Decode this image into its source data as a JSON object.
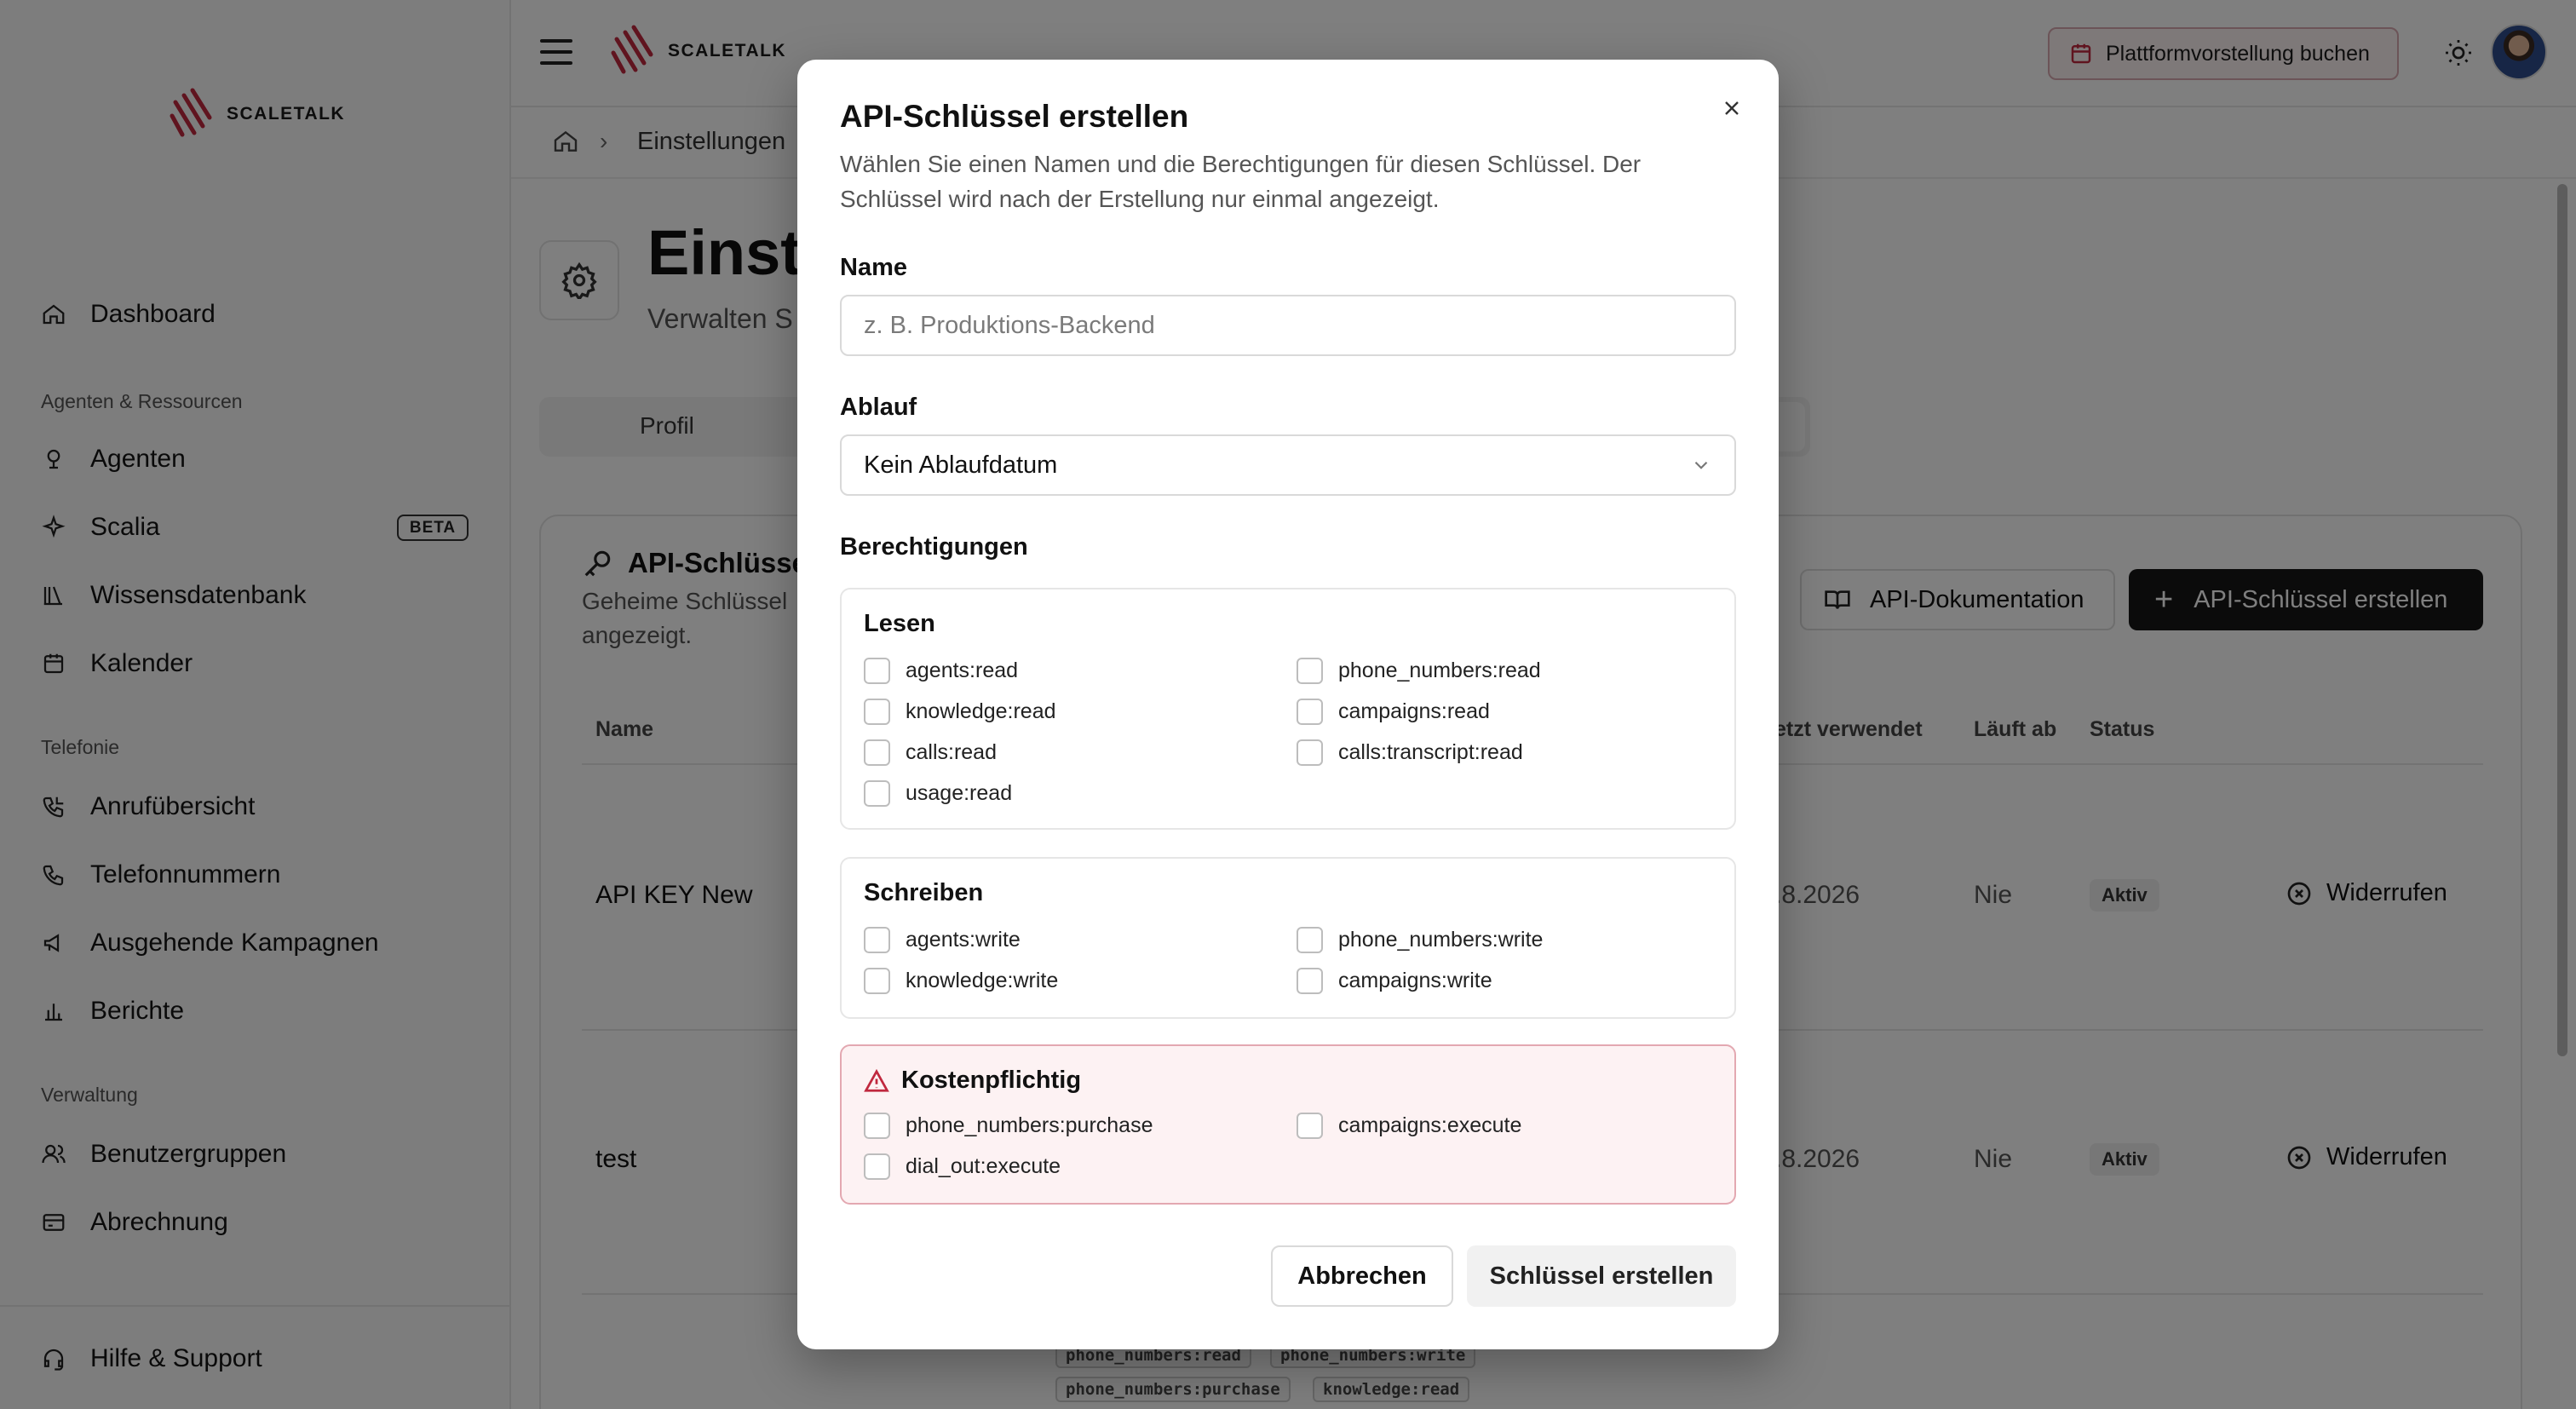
{
  "brand": {
    "name": "SCALETALK",
    "accent": "#c0283e"
  },
  "topbar": {
    "demo_button": "Plattformvorstellung buchen"
  },
  "sidebar": {
    "dashboard": "Dashboard",
    "sections": {
      "resources": "Agenten & Ressourcen",
      "telephony": "Telefonie",
      "admin": "Verwaltung"
    },
    "items": {
      "agents": "Agenten",
      "scalia": "Scalia",
      "scalia_badge": "BETA",
      "knowledge": "Wissensdatenbank",
      "calendar": "Kalender",
      "calls": "Anrufübersicht",
      "numbers": "Telefonnummern",
      "campaigns": "Ausgehende Kampagnen",
      "reports": "Berichte",
      "groups": "Benutzergruppen",
      "billing": "Abrechnung"
    },
    "help": "Hilfe & Support"
  },
  "breadcrumb": {
    "current": "Einstellungen"
  },
  "page": {
    "title": "Einste",
    "subtitle": "Verwalten S",
    "tab_profile": "Profil"
  },
  "api_card": {
    "title": "API-Schlüsse",
    "description": "Geheime Schlüssel angezeigt.",
    "docs_button": "API-Dokumentation",
    "create_button": "API-Schlüssel erstellen",
    "columns": {
      "name": "Name",
      "last_used": "etzt verwendet",
      "expires": "Läuft ab",
      "status": "Status"
    },
    "rows": [
      {
        "name": "API KEY New",
        "last_used": ".8.2026",
        "expires": "Nie",
        "status": "Aktiv",
        "action": "Widerrufen"
      },
      {
        "name": "test",
        "last_used": ".8.2026",
        "expires": "Nie",
        "status": "Aktiv",
        "action": "Widerrufen"
      }
    ],
    "scope_chips": [
      "phone_numbers:read",
      "phone_numbers:write",
      "phone_numbers:purchase",
      "knowledge:read"
    ]
  },
  "modal": {
    "title": "API-Schlüssel erstellen",
    "description": "Wählen Sie einen Namen und die Berechtigungen für diesen Schlüssel. Der Schlüssel wird nach der Erstellung nur einmal angezeigt.",
    "name_label": "Name",
    "name_placeholder": "z. B. Produktions-Backend",
    "name_value": "",
    "expiry_label": "Ablauf",
    "expiry_value": "Kein Ablaufdatum",
    "permissions_label": "Berechtigungen",
    "groups": {
      "read": {
        "title": "Lesen",
        "perms": [
          "agents:read",
          "phone_numbers:read",
          "knowledge:read",
          "campaigns:read",
          "calls:read",
          "calls:transcript:read",
          "usage:read"
        ]
      },
      "write": {
        "title": "Schreiben",
        "perms": [
          "agents:write",
          "phone_numbers:write",
          "knowledge:write",
          "campaigns:write"
        ]
      },
      "cost": {
        "title": "Kostenpflichtig",
        "perms": [
          "phone_numbers:purchase",
          "campaigns:execute",
          "dial_out:execute"
        ]
      }
    },
    "cancel": "Abbrechen",
    "submit": "Schlüssel erstellen"
  }
}
